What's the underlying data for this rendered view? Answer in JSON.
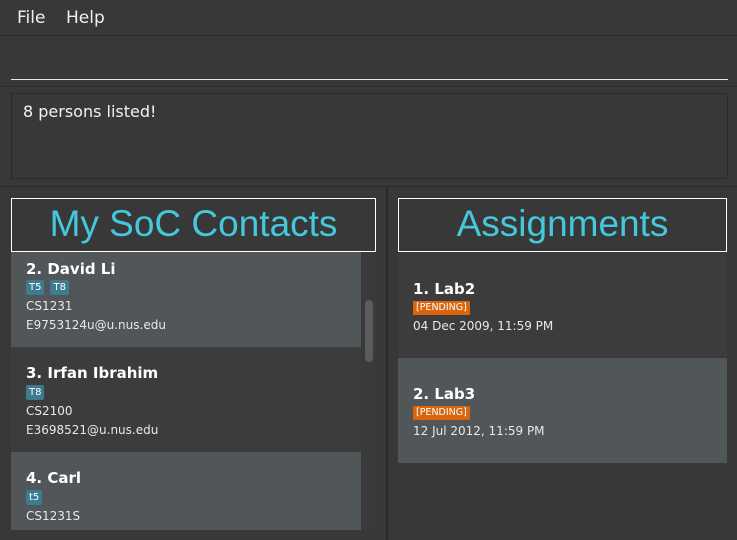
{
  "menu": {
    "file": "File",
    "help": "Help"
  },
  "command": {
    "value": "",
    "placeholder": ""
  },
  "result": {
    "text": "8 persons listed!"
  },
  "contacts": {
    "title": "My SoC Contacts",
    "items": [
      {
        "name": "2.  David Li",
        "tags": [
          "T5",
          "T8"
        ],
        "line1": "CS1231",
        "line2": "E9753124u@u.nus.edu"
      },
      {
        "name": "3.  Irfan Ibrahim",
        "tags": [
          "T8"
        ],
        "line1": "CS2100",
        "line2": "E3698521@u.nus.edu"
      },
      {
        "name": "4.  Carl",
        "tags": [
          "t5"
        ],
        "line1": "CS1231S",
        "line2": ""
      }
    ]
  },
  "assignments": {
    "title": "Assignments",
    "items": [
      {
        "name": "1.  Lab2",
        "status": "[PENDING]",
        "due": "04 Dec 2009, 11:59 PM"
      },
      {
        "name": "2.  Lab3",
        "status": "[PENDING]",
        "due": "12 Jul 2012, 11:59 PM"
      }
    ]
  },
  "colors": {
    "accent": "#45c8dc",
    "tag": "#3e7b91",
    "pending": "#d9650f",
    "background": "#383838"
  }
}
